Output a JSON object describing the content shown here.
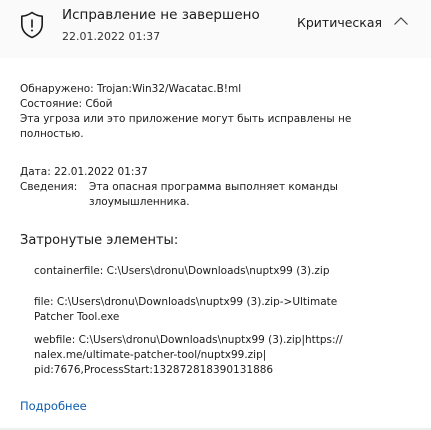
{
  "header": {
    "icon": "shield-icon",
    "title": "Исправление не завершено",
    "date": "22.01.2022 01:37",
    "severity": "Критическая",
    "toggle_icon": "chevron-up-icon"
  },
  "details": {
    "detected_label": "Обнаружено:",
    "detected_value": "Trojan:Win32/Wacatac.B!ml",
    "status_label": "Состояние:",
    "status_value": "Сбой",
    "message_line1": "Эта угроза или это приложение могут быть исправлены не",
    "message_line2": "полностью.",
    "date_label": "Дата:",
    "date_value": "22.01.2022 01:37",
    "info_label": "Сведения:",
    "info_line1": "Эта опасная программа выполняет команды",
    "info_line2": "злоумышленника."
  },
  "affected": {
    "title": "Затронутые элементы:",
    "containerfile": "containerfile: C:\\Users\\dronu\\Downloads\\nuptx99 (3).zip",
    "file_line1": "file: C:\\Users\\dronu\\Downloads\\nuptx99 (3).zip->Ultimate",
    "file_line2": "Patcher Tool.exe",
    "webfile_line1": "webfile: C:\\Users\\dronu\\Downloads\\nuptx99 (3).zip|https://",
    "webfile_line2": "nalex.me/ultimate-patcher-tool/nuptx99.zip|",
    "webfile_line3": "pid:7676,ProcessStart:132872818390131886"
  },
  "more_link": "Подробнее",
  "colors": {
    "header_bg": "#fafafa",
    "link": "#0b5cad",
    "text": "#1b1b1b"
  }
}
